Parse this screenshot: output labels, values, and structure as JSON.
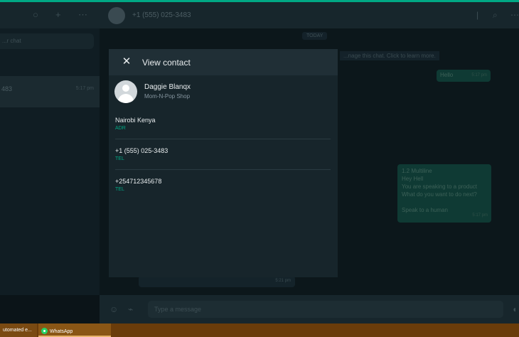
{
  "sidebar": {
    "search_placeholder": "...r chat",
    "chat_number": "483",
    "chat_time": "5:17 pm"
  },
  "chat": {
    "header_title": "+1 (555) 025-3483",
    "date_chip": "TODAY",
    "system_note": "...nage this chat. Click to learn more.",
    "hello_text": "Hello",
    "hello_time": "5:17 pm",
    "list_lines": [
      "1.2 Multiline",
      "Hey Hell",
      "You are speaking to a product",
      "What do you want to do next?",
      "",
      "Speak to a human"
    ],
    "list_time": "5:17 pm",
    "incoming_time": "5:21 pm",
    "composer_placeholder": "Type a message"
  },
  "taskbar": {
    "item1": "utomated e...",
    "item2": "WhatsApp"
  },
  "modal": {
    "title": "View contact",
    "contact_name": "Daggie Blanqx",
    "contact_org": "Mom-N-Pop Shop",
    "fields": [
      {
        "value": "Nairobi Kenya",
        "label": "ADR"
      },
      {
        "value": "+1 (555) 025-3483",
        "label": "TEL"
      },
      {
        "value": "+254712345678",
        "label": "TEL"
      }
    ]
  },
  "colors": {
    "accent": "#00a884",
    "taskbar": "#6a3c0a"
  }
}
